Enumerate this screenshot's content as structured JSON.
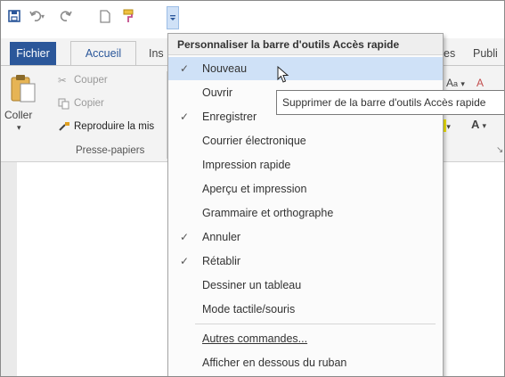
{
  "qat": {
    "save_icon": "save-icon",
    "undo_icon": "undo-icon",
    "redo_icon": "redo-icon",
    "new_icon": "new-document-icon",
    "brush_icon": "format-painter-icon",
    "dropdown_icon": "customize-dropdown-icon"
  },
  "tabs": {
    "fichier": "Fichier",
    "accueil": "Accueil",
    "insertion_partial": "Ins",
    "partial_es": "es",
    "partial_publi": "Publi"
  },
  "clipboard": {
    "coller": "Coller",
    "couper": "Couper",
    "copier": "Copier",
    "reproduire": "Reproduire la mis",
    "group_label": "Presse-papiers"
  },
  "font_group": {
    "aa": "A",
    "a_down": "A",
    "caret": "▾",
    "underline_a": "A"
  },
  "menu": {
    "title": "Personnaliser la barre d'outils Accès rapide",
    "items": [
      {
        "label": "Nouveau",
        "checked": true
      },
      {
        "label": "Ouvrir",
        "checked": false
      },
      {
        "label": "Enregistrer",
        "checked": true
      },
      {
        "label": "Courrier électronique",
        "checked": false
      },
      {
        "label": "Impression rapide",
        "checked": false
      },
      {
        "label": "Aperçu et impression",
        "checked": false
      },
      {
        "label": "Grammaire et orthographe",
        "checked": false
      },
      {
        "label": "Annuler",
        "checked": true
      },
      {
        "label": "Rétablir",
        "checked": true
      },
      {
        "label": "Dessiner un tableau",
        "checked": false
      },
      {
        "label": "Mode tactile/souris",
        "checked": false
      }
    ],
    "more_commands": "Autres commandes...",
    "show_below": "Afficher en dessous du ruban",
    "check_glyph": "✓"
  },
  "tooltip": {
    "text": "Supprimer de la barre d'outils Accès rapide"
  },
  "colors": {
    "accent": "#2b579a",
    "hover": "#cfe1f7"
  }
}
